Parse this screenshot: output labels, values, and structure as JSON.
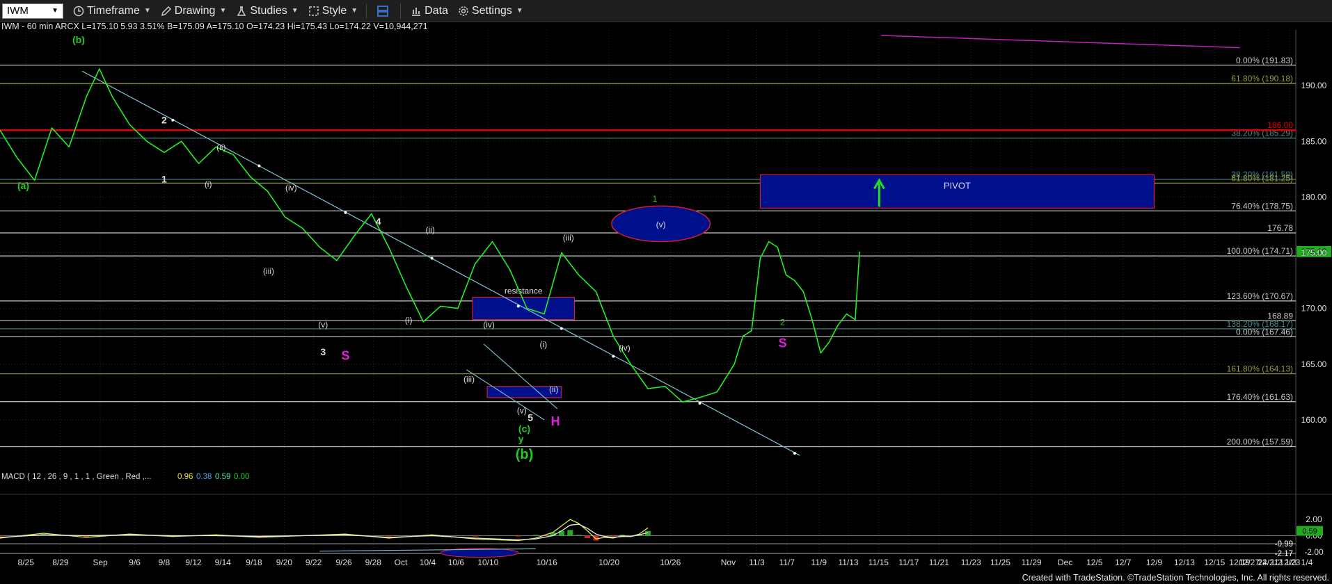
{
  "toolbar": {
    "symbol": "IWM",
    "timeframe": "Timeframe",
    "drawing": "Drawing",
    "studies": "Studies",
    "style": "Style",
    "data": "Data",
    "settings": "Settings"
  },
  "chart_data": {
    "type": "line",
    "header": "IWM - 60 min  ARCX  L=175.10  5.93  3.51%  B=175.09  A=175.10  O=174.23  Hi=175.43  Lo=174.22  V=10,944,271",
    "ylim": [
      155,
      195
    ],
    "yticks": [
      160.0,
      165.0,
      170.0,
      175.0,
      180.0,
      185.0,
      190.0
    ],
    "ytick_labels": [
      "160.00",
      "165.00",
      "170.00",
      "175.00",
      "180.00",
      "185.00",
      "190.00"
    ],
    "xlim": [
      0,
      150
    ],
    "xtick_labels": [
      {
        "x": 3,
        "label": "8/25"
      },
      {
        "x": 7,
        "label": "8/29"
      },
      {
        "x": 11.6,
        "label": "Sep"
      },
      {
        "x": 15.6,
        "label": "9/6"
      },
      {
        "x": 19,
        "label": "9/8"
      },
      {
        "x": 22.4,
        "label": "9/12"
      },
      {
        "x": 25.8,
        "label": "9/14"
      },
      {
        "x": 29.4,
        "label": "9/18"
      },
      {
        "x": 32.9,
        "label": "9/20"
      },
      {
        "x": 36.3,
        "label": "9/22"
      },
      {
        "x": 39.8,
        "label": "9/26"
      },
      {
        "x": 43.2,
        "label": "9/28"
      },
      {
        "x": 46.4,
        "label": "Oct"
      },
      {
        "x": 49.5,
        "label": "10/4"
      },
      {
        "x": 52.8,
        "label": "10/6"
      },
      {
        "x": 56.5,
        "label": "10/10"
      },
      {
        "x": 63.3,
        "label": "10/16"
      },
      {
        "x": 70.5,
        "label": "10/20"
      },
      {
        "x": 77.6,
        "label": "10/26"
      },
      {
        "x": 84.3,
        "label": "Nov"
      },
      {
        "x": 87.6,
        "label": "11/3"
      },
      {
        "x": 91.1,
        "label": "11/7"
      },
      {
        "x": 94.8,
        "label": "11/9"
      },
      {
        "x": 98.2,
        "label": "11/13"
      },
      {
        "x": 101.7,
        "label": "11/15"
      },
      {
        "x": 105.2,
        "label": "11/17"
      },
      {
        "x": 108.7,
        "label": "11/21"
      },
      {
        "x": 112.4,
        "label": "11/23"
      },
      {
        "x": 115.8,
        "label": "11/25"
      },
      {
        "x": 119.4,
        "label": "11/29"
      },
      {
        "x": 123.3,
        "label": "Dec"
      },
      {
        "x": 126.7,
        "label": "12/5"
      },
      {
        "x": 130,
        "label": "12/7"
      },
      {
        "x": 133.6,
        "label": "12/9"
      },
      {
        "x": 137.1,
        "label": "12/13"
      },
      {
        "x": 140.6,
        "label": "12/15"
      },
      {
        "x": 143.5,
        "label": "12/19"
      },
      {
        "x": 146.8,
        "label": "12/21"
      },
      {
        "x": 149.3,
        "label": "12/23"
      }
    ],
    "xtick_extra": [
      "12/27",
      "'24",
      "1/2",
      "1/3",
      "1/4"
    ],
    "price_series": {
      "name": "IWM",
      "x": [
        0,
        2,
        4,
        6,
        8,
        10,
        11.5,
        13,
        15,
        17,
        19,
        21,
        23,
        25,
        27,
        29,
        31,
        33,
        35,
        37,
        39,
        41,
        43,
        45,
        47,
        49,
        51,
        53,
        55,
        57,
        59,
        61,
        63,
        65,
        67,
        69,
        71,
        73,
        75,
        77,
        79,
        81,
        83,
        85,
        86,
        87,
        88,
        89,
        90,
        91,
        92,
        93,
        94,
        95,
        96,
        97,
        98,
        99,
        99.5
      ],
      "y": [
        186.0,
        183.5,
        181.5,
        186.2,
        184.5,
        189.0,
        191.5,
        189.0,
        186.5,
        185.0,
        184.0,
        185.0,
        183.0,
        184.5,
        183.8,
        181.8,
        180.5,
        178.2,
        177.2,
        175.5,
        174.3,
        176.5,
        178.5,
        175.5,
        172.0,
        168.8,
        170.2,
        170.0,
        174.0,
        176.0,
        173.5,
        170.0,
        169.5,
        175.0,
        173.0,
        171.5,
        167.5,
        165.0,
        162.8,
        163.0,
        161.6,
        162.0,
        162.5,
        165.0,
        167.5,
        168.0,
        174.5,
        176.0,
        175.5,
        173.0,
        172.5,
        171.5,
        169.0,
        166.0,
        167.0,
        168.5,
        169.5,
        169.0,
        175.1
      ]
    },
    "current_price_label": "175.10",
    "fib_levels": [
      {
        "y": 191.83,
        "label": "0.00% (191.83)",
        "color": "#c8c8c8"
      },
      {
        "y": 190.18,
        "label": "61.80% (190.18)",
        "color": "#9a9a3a"
      },
      {
        "y": 185.29,
        "label": "38.20% (185.29)",
        "color": "#4a8a8a"
      },
      {
        "y": 181.58,
        "label": "38.20% (181.58)",
        "color": "#4a8a8a"
      },
      {
        "y": 181.25,
        "label": "61.80% (181.25)",
        "color": "#9a9a3a"
      },
      {
        "y": 178.75,
        "label": "76.40% (178.75)",
        "color": "#c8c8c8"
      },
      {
        "y": 176.78,
        "label": "176.78",
        "color": "#c8c8c8"
      },
      {
        "y": 174.71,
        "label": "100.00% (174.71)",
        "color": "#c8c8c8"
      },
      {
        "y": 170.67,
        "label": "123.60% (170.67)",
        "color": "#c8c8c8"
      },
      {
        "y": 168.89,
        "label": "168.89",
        "color": "#c8c8c8"
      },
      {
        "y": 168.17,
        "label": "138.20% (168.17)",
        "color": "#4a8a8a"
      },
      {
        "y": 167.46,
        "label": "0.00% (167.46)",
        "color": "#c8c8c8"
      },
      {
        "y": 164.13,
        "label": "161.80% (164.13)",
        "color": "#9a9a3a"
      },
      {
        "y": 161.63,
        "label": "176.40% (161.63)",
        "color": "#c8c8c8"
      },
      {
        "y": 157.59,
        "label": "200.00% (157.59)",
        "color": "#c8c8c8"
      }
    ],
    "red_line": {
      "y": 186.0,
      "label": "186.00",
      "color": "#e00000"
    },
    "pivot_box": {
      "x0": 88.0,
      "x1": 133.6,
      "y0": 179.0,
      "y1": 182.0,
      "label": "PIVOT",
      "color": "#00108c"
    },
    "resistance_box": {
      "x0": 54.7,
      "x1": 66.5,
      "y0": 169.0,
      "y1": 171.0,
      "label": "resistance",
      "color": "#00108c"
    },
    "support_box": {
      "x0": 56.4,
      "x1": 65.0,
      "y0": 162.0,
      "y1": 163.0,
      "color": "#00108c"
    },
    "target_ellipse": {
      "cx": 76.5,
      "cy": 177.6,
      "rx": 5.7,
      "ry": 1.6,
      "label": "(v)",
      "color": "#00108c"
    },
    "trendline": [
      {
        "x": 9.5,
        "y": 191.3
      },
      {
        "x": 92.6,
        "y": 156.8
      }
    ],
    "trendline_dots": [
      {
        "x": 20,
        "y": 186.9
      },
      {
        "x": 30,
        "y": 182.8
      },
      {
        "x": 40,
        "y": 178.6
      },
      {
        "x": 50,
        "y": 174.5
      },
      {
        "x": 60,
        "y": 170.2
      },
      {
        "x": 65,
        "y": 168.2
      },
      {
        "x": 71,
        "y": 165.7
      },
      {
        "x": 81,
        "y": 161.5
      },
      {
        "x": 92,
        "y": 157.0
      }
    ],
    "channel_lines": [
      [
        {
          "x": 56,
          "y": 166.8
        },
        {
          "x": 64.5,
          "y": 161.0
        }
      ],
      [
        {
          "x": 54,
          "y": 164.5
        },
        {
          "x": 63,
          "y": 160.0
        }
      ]
    ],
    "magenta_line": [
      {
        "x": 102,
        "y": 194.5
      },
      {
        "x": 143.5,
        "y": 193.4
      }
    ],
    "wave_labels": [
      {
        "x": 9.1,
        "y": 193.8,
        "text": "(b)",
        "color": "#22cc22",
        "size": 14
      },
      {
        "x": 2.7,
        "y": 180.7,
        "text": "(a)",
        "color": "#22cc22",
        "size": 14
      },
      {
        "x": 19,
        "y": 186.6,
        "text": "2",
        "color": "#dddddd",
        "size": 14
      },
      {
        "x": 19,
        "y": 181.3,
        "text": "1",
        "color": "#dddddd",
        "size": 14
      },
      {
        "x": 25.6,
        "y": 184.2,
        "text": "(ii)",
        "color": "#dddddd",
        "size": 12
      },
      {
        "x": 24.1,
        "y": 180.9,
        "text": "(i)",
        "color": "#dddddd",
        "size": 12
      },
      {
        "x": 33.7,
        "y": 180.6,
        "text": "(iv)",
        "color": "#dddddd",
        "size": 12
      },
      {
        "x": 31.1,
        "y": 173.1,
        "text": "(iii)",
        "color": "#dddddd",
        "size": 12
      },
      {
        "x": 43.8,
        "y": 177.5,
        "text": "4",
        "color": "#dddddd",
        "size": 14
      },
      {
        "x": 49.8,
        "y": 176.8,
        "text": "(ii)",
        "color": "#dddddd",
        "size": 12
      },
      {
        "x": 37.4,
        "y": 168.3,
        "text": "(v)",
        "color": "#dddddd",
        "size": 12
      },
      {
        "x": 37.4,
        "y": 165.8,
        "text": "3",
        "color": "#dddddd",
        "size": 14
      },
      {
        "x": 40,
        "y": 165.4,
        "text": "S",
        "color": "#e020e0",
        "size": 18
      },
      {
        "x": 47.3,
        "y": 168.7,
        "text": "(i)",
        "color": "#dddddd",
        "size": 12
      },
      {
        "x": 56.6,
        "y": 168.3,
        "text": "(iv)",
        "color": "#dddddd",
        "size": 12
      },
      {
        "x": 54.3,
        "y": 163.4,
        "text": "(iii)",
        "color": "#dddddd",
        "size": 12
      },
      {
        "x": 62.9,
        "y": 166.5,
        "text": "(i)",
        "color": "#dddddd",
        "size": 12
      },
      {
        "x": 64.1,
        "y": 162.5,
        "text": "(ii)",
        "color": "#dddddd",
        "size": 12
      },
      {
        "x": 60.4,
        "y": 160.6,
        "text": "(v)",
        "color": "#dddddd",
        "size": 12
      },
      {
        "x": 61.4,
        "y": 159.9,
        "text": "5",
        "color": "#dddddd",
        "size": 14
      },
      {
        "x": 60.7,
        "y": 158.9,
        "text": "(c)",
        "color": "#22cc22",
        "size": 14
      },
      {
        "x": 60.3,
        "y": 158.0,
        "text": "y",
        "color": "#22cc22",
        "size": 14
      },
      {
        "x": 60.7,
        "y": 156.5,
        "text": "(b)",
        "color": "#22cc22",
        "size": 20
      },
      {
        "x": 64.3,
        "y": 159.5,
        "text": "H",
        "color": "#e020e0",
        "size": 18
      },
      {
        "x": 65.8,
        "y": 176.1,
        "text": "(iii)",
        "color": "#dddddd",
        "size": 12
      },
      {
        "x": 72.3,
        "y": 166.2,
        "text": "(iv)",
        "color": "#dddddd",
        "size": 12
      },
      {
        "x": 75.8,
        "y": 179.6,
        "text": "1",
        "color": "#22cc22",
        "size": 12
      },
      {
        "x": 90.6,
        "y": 168.5,
        "text": "2",
        "color": "#22cc22",
        "size": 12
      },
      {
        "x": 90.6,
        "y": 166.5,
        "text": "S",
        "color": "#e020e0",
        "size": 18
      }
    ],
    "macd": {
      "header": "MACD ( 12 , 26 , 9 , 1 , 1 , Green , Red ,...",
      "values": [
        "0.96",
        "0.38",
        "0.59",
        "0.00"
      ],
      "value_colors": [
        "#e6e64a",
        "#4aa0e6",
        "#4ae6a0",
        "#22cc22"
      ],
      "ylim": [
        -2.6,
        3.2
      ],
      "yticks": [
        {
          "y": 2.0,
          "label": "2.00"
        },
        {
          "y": 0.0,
          "label": "0.00"
        },
        {
          "y": -2.0,
          "label": "-2.00"
        }
      ],
      "markers": [
        {
          "y": 0.59,
          "label": "0.59",
          "color": "#22aa22"
        },
        {
          "y": -0.99,
          "label": "-0.99",
          "color": "#ffffff"
        },
        {
          "y": -2.17,
          "label": "-2.17",
          "color": "#ffffff"
        }
      ],
      "macd_line": {
        "x": [
          0,
          5,
          10,
          15,
          20,
          25,
          30,
          35,
          40,
          45,
          50,
          55,
          60,
          62,
          64,
          65,
          66,
          67,
          68,
          69,
          70,
          71,
          72,
          73,
          74,
          75
        ],
        "y": [
          -0.3,
          0.3,
          -0.2,
          0.2,
          -0.1,
          0.1,
          -0.2,
          0.0,
          0.2,
          -0.3,
          0.1,
          -0.4,
          -0.6,
          -0.3,
          0.4,
          1.2,
          2.0,
          1.5,
          0.6,
          -0.4,
          -0.2,
          -0.3,
          0.0,
          -0.1,
          0.2,
          0.96
        ]
      },
      "signal_line": {
        "x": [
          0,
          5,
          10,
          15,
          20,
          25,
          30,
          35,
          40,
          45,
          50,
          55,
          60,
          62,
          64,
          65,
          66,
          67,
          68,
          69,
          70,
          71,
          72,
          73,
          74,
          75
        ],
        "y": [
          -0.2,
          0.1,
          0.0,
          0.1,
          0.0,
          0.0,
          -0.1,
          0.0,
          0.1,
          -0.2,
          0.0,
          -0.3,
          -0.5,
          -0.4,
          0.0,
          0.6,
          1.3,
          1.4,
          0.9,
          0.2,
          -0.1,
          -0.2,
          -0.1,
          -0.1,
          0.1,
          0.38
        ]
      },
      "ellipse": {
        "cx": 55.5,
        "cy": -2.1,
        "rx": 4.5,
        "ry": 0.55
      },
      "trend": [
        {
          "x": 37,
          "y": -1.9
        },
        {
          "x": 62,
          "y": -1.6
        }
      ]
    }
  },
  "footer": "Created with TradeStation. ©TradeStation Technologies, Inc. All rights reserved."
}
